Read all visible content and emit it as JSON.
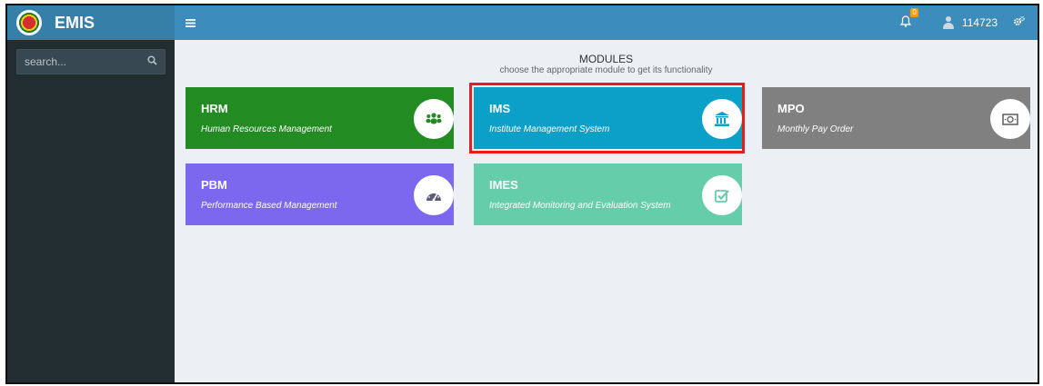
{
  "app": {
    "title": "EMIS"
  },
  "sidebar": {
    "search_placeholder": "search..."
  },
  "topbar": {
    "notification_count": "0",
    "user_id": "114723"
  },
  "modules": {
    "heading": "MODULES",
    "subheading": "choose the appropriate module to get its functionality",
    "items": [
      {
        "name": "HRM",
        "description": "Human Resources Management",
        "color": "#228b22",
        "icon": "users-icon"
      },
      {
        "name": "IMS",
        "description": "Institute Management System",
        "color": "#0aa0c7",
        "icon": "bank-icon",
        "selected": true
      },
      {
        "name": "MPO",
        "description": "Monthly Pay Order",
        "color": "#808080",
        "icon": "money-icon"
      },
      {
        "name": "PBM",
        "description": "Performance Based Management",
        "color": "#7b68ee",
        "icon": "dashboard-icon"
      },
      {
        "name": "IMES",
        "description": "Integrated Monitoring and Evaluation System",
        "color": "#66cdaa",
        "icon": "check-square-icon"
      }
    ]
  }
}
